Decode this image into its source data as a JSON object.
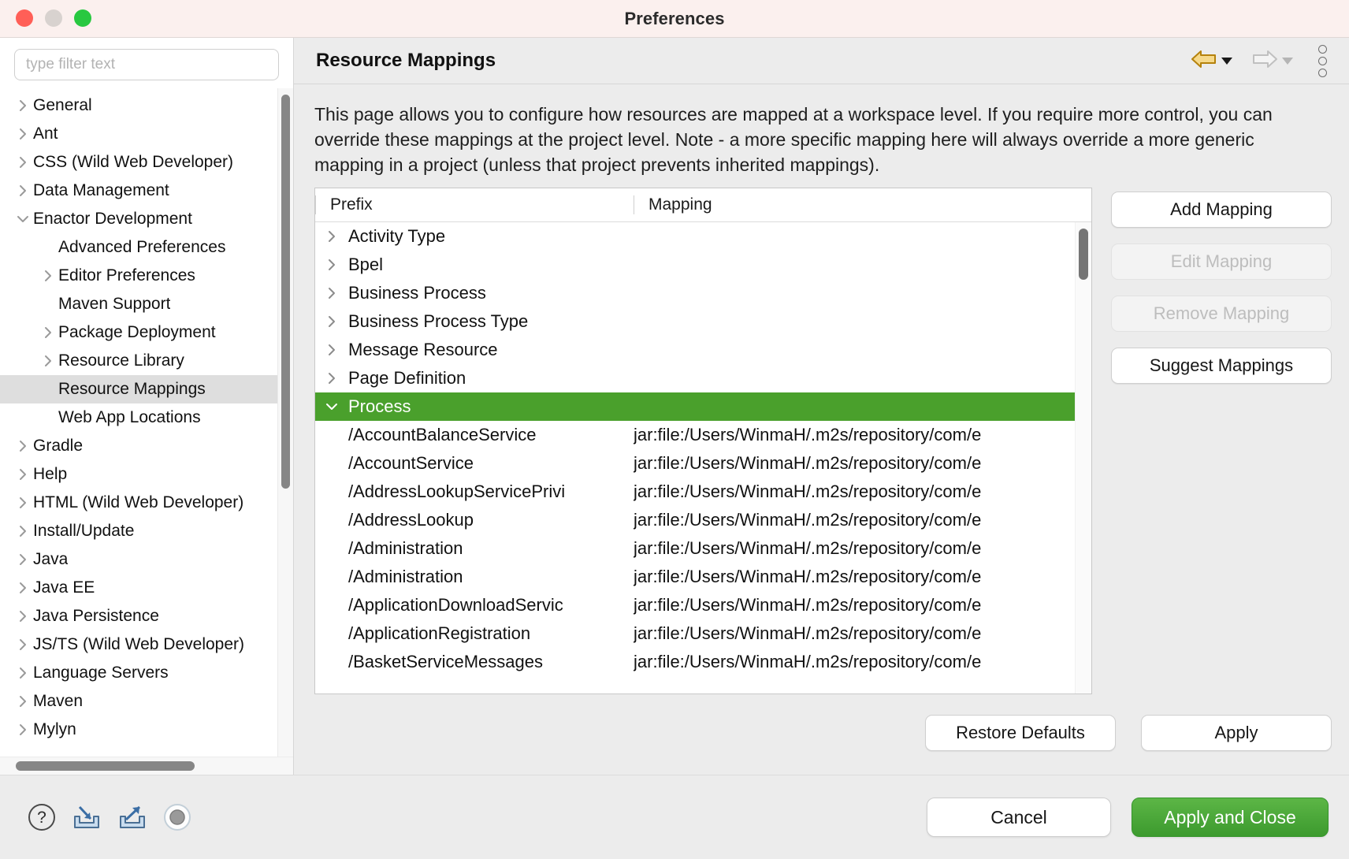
{
  "window": {
    "title": "Preferences",
    "traffic_lights": [
      "close",
      "minimize",
      "maximize"
    ]
  },
  "sidebar": {
    "filter": {
      "placeholder": "type filter text",
      "value": ""
    },
    "items": [
      {
        "label": "General",
        "indent": 0,
        "twisty": "collapsed",
        "selected": false
      },
      {
        "label": "Ant",
        "indent": 0,
        "twisty": "collapsed",
        "selected": false
      },
      {
        "label": "CSS (Wild Web Developer)",
        "indent": 0,
        "twisty": "collapsed",
        "selected": false
      },
      {
        "label": "Data Management",
        "indent": 0,
        "twisty": "collapsed",
        "selected": false
      },
      {
        "label": "Enactor Development",
        "indent": 0,
        "twisty": "expanded",
        "selected": false
      },
      {
        "label": "Advanced Preferences",
        "indent": 1,
        "twisty": "none",
        "selected": false
      },
      {
        "label": "Editor Preferences",
        "indent": 1,
        "twisty": "collapsed",
        "selected": false
      },
      {
        "label": "Maven Support",
        "indent": 1,
        "twisty": "none",
        "selected": false
      },
      {
        "label": "Package Deployment",
        "indent": 1,
        "twisty": "collapsed",
        "selected": false
      },
      {
        "label": "Resource Library",
        "indent": 1,
        "twisty": "collapsed",
        "selected": false
      },
      {
        "label": "Resource Mappings",
        "indent": 1,
        "twisty": "none",
        "selected": true
      },
      {
        "label": "Web App Locations",
        "indent": 1,
        "twisty": "none",
        "selected": false
      },
      {
        "label": "Gradle",
        "indent": 0,
        "twisty": "collapsed",
        "selected": false
      },
      {
        "label": "Help",
        "indent": 0,
        "twisty": "collapsed",
        "selected": false
      },
      {
        "label": "HTML (Wild Web Developer)",
        "indent": 0,
        "twisty": "collapsed",
        "selected": false
      },
      {
        "label": "Install/Update",
        "indent": 0,
        "twisty": "collapsed",
        "selected": false
      },
      {
        "label": "Java",
        "indent": 0,
        "twisty": "collapsed",
        "selected": false
      },
      {
        "label": "Java EE",
        "indent": 0,
        "twisty": "collapsed",
        "selected": false
      },
      {
        "label": "Java Persistence",
        "indent": 0,
        "twisty": "collapsed",
        "selected": false
      },
      {
        "label": "JS/TS (Wild Web Developer)",
        "indent": 0,
        "twisty": "collapsed",
        "selected": false
      },
      {
        "label": "Language Servers",
        "indent": 0,
        "twisty": "collapsed",
        "selected": false
      },
      {
        "label": "Maven",
        "indent": 0,
        "twisty": "collapsed",
        "selected": false
      },
      {
        "label": "Mylyn",
        "indent": 0,
        "twisty": "collapsed",
        "selected": false
      }
    ]
  },
  "page": {
    "title": "Resource Mappings",
    "nav": {
      "back_icon": "back-arrow-icon",
      "back_dropdown_icon": "chevron-down-icon",
      "forward_icon": "forward-arrow-icon",
      "forward_dropdown_icon": "chevron-down-icon",
      "menu_icon": "kebab-menu-icon"
    },
    "description": "This page allows you to configure how resources are mapped at a workspace level. If you require more control, you can override these mappings at the project level. Note - a more specific mapping here will always override a more generic mapping in a project (unless that project prevents inherited mappings)."
  },
  "table": {
    "columns": [
      "Prefix",
      "Mapping"
    ],
    "rows": [
      {
        "prefix": "Activity Type",
        "mapping": "",
        "type": "group",
        "twisty": "collapsed",
        "selected": false
      },
      {
        "prefix": "Bpel",
        "mapping": "",
        "type": "group",
        "twisty": "collapsed",
        "selected": false
      },
      {
        "prefix": "Business Process",
        "mapping": "",
        "type": "group",
        "twisty": "collapsed",
        "selected": false
      },
      {
        "prefix": "Business Process Type",
        "mapping": "",
        "type": "group",
        "twisty": "collapsed",
        "selected": false
      },
      {
        "prefix": "Message Resource",
        "mapping": "",
        "type": "group",
        "twisty": "collapsed",
        "selected": false
      },
      {
        "prefix": "Page Definition",
        "mapping": "",
        "type": "group",
        "twisty": "collapsed",
        "selected": false
      },
      {
        "prefix": "Process",
        "mapping": "",
        "type": "group",
        "twisty": "expanded",
        "selected": true
      },
      {
        "prefix": "/AccountBalanceService",
        "mapping": "jar:file:/Users/WinmaH/.m2s/repository/com/e",
        "type": "child",
        "twisty": "none",
        "selected": false
      },
      {
        "prefix": "/AccountService",
        "mapping": "jar:file:/Users/WinmaH/.m2s/repository/com/e",
        "type": "child",
        "twisty": "none",
        "selected": false
      },
      {
        "prefix": "/AddressLookupServicePrivi",
        "mapping": "jar:file:/Users/WinmaH/.m2s/repository/com/e",
        "type": "child",
        "twisty": "none",
        "selected": false
      },
      {
        "prefix": "/AddressLookup",
        "mapping": "jar:file:/Users/WinmaH/.m2s/repository/com/e",
        "type": "child",
        "twisty": "none",
        "selected": false
      },
      {
        "prefix": "/Administration",
        "mapping": "jar:file:/Users/WinmaH/.m2s/repository/com/e",
        "type": "child",
        "twisty": "none",
        "selected": false
      },
      {
        "prefix": "/Administration",
        "mapping": "jar:file:/Users/WinmaH/.m2s/repository/com/e",
        "type": "child",
        "twisty": "none",
        "selected": false
      },
      {
        "prefix": "/ApplicationDownloadServic",
        "mapping": "jar:file:/Users/WinmaH/.m2s/repository/com/e",
        "type": "child",
        "twisty": "none",
        "selected": false
      },
      {
        "prefix": "/ApplicationRegistration",
        "mapping": "jar:file:/Users/WinmaH/.m2s/repository/com/e",
        "type": "child",
        "twisty": "none",
        "selected": false
      },
      {
        "prefix": "/BasketServiceMessages",
        "mapping": "jar:file:/Users/WinmaH/.m2s/repository/com/e",
        "type": "child",
        "twisty": "none",
        "selected": false
      }
    ]
  },
  "side_buttons": [
    {
      "label": "Add Mapping",
      "enabled": true
    },
    {
      "label": "Edit Mapping",
      "enabled": false
    },
    {
      "label": "Remove Mapping",
      "enabled": false
    },
    {
      "label": "Suggest Mappings",
      "enabled": true
    }
  ],
  "page_buttons": {
    "restore_defaults": "Restore Defaults",
    "apply": "Apply"
  },
  "footer": {
    "icons": [
      "help-icon",
      "import-icon",
      "export-icon",
      "record-icon"
    ],
    "cancel": "Cancel",
    "apply_and_close": "Apply and Close"
  },
  "colors": {
    "selection_green": "#4aa02c",
    "apply_close_green": "#3c9a2e",
    "titlebar": "#fbf0ee",
    "panel": "#ececec",
    "back_arrow_gold": "#c08a13"
  }
}
